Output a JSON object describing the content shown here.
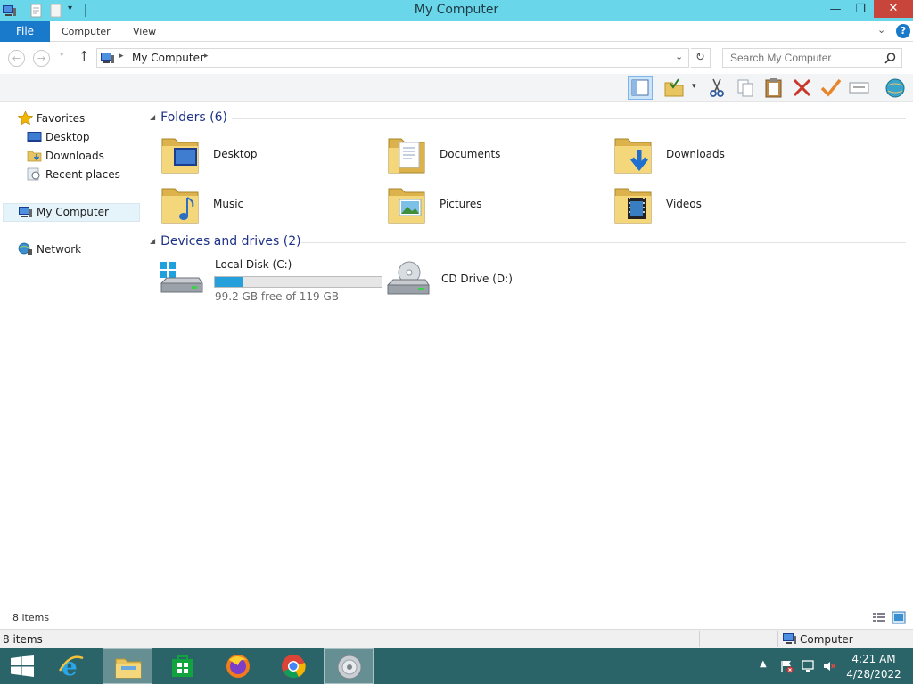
{
  "window": {
    "title": "My Computer"
  },
  "ribbon": {
    "tabs": [
      "File",
      "Computer",
      "View"
    ]
  },
  "address": {
    "path": "My Computer",
    "search_placeholder": "Search My Computer"
  },
  "navigation": {
    "favorites_label": "Favorites",
    "favorites": [
      "Desktop",
      "Downloads",
      "Recent places"
    ],
    "my_computer_label": "My Computer",
    "network_label": "Network"
  },
  "folders": {
    "header": "Folders (6)",
    "items": [
      {
        "name": "Desktop",
        "icon": "desktop-folder-icon"
      },
      {
        "name": "Documents",
        "icon": "documents-folder-icon"
      },
      {
        "name": "Downloads",
        "icon": "downloads-folder-icon"
      },
      {
        "name": "Music",
        "icon": "music-folder-icon"
      },
      {
        "name": "Pictures",
        "icon": "pictures-folder-icon"
      },
      {
        "name": "Videos",
        "icon": "videos-folder-icon"
      }
    ]
  },
  "drives": {
    "header": "Devices and drives (2)",
    "items": [
      {
        "name": "Local Disk (C:)",
        "free_text": "99.2 GB free of 119 GB",
        "used_fraction": 0.17,
        "icon": "hard-drive-icon"
      },
      {
        "name": "CD Drive (D:)",
        "icon": "cd-drive-icon"
      }
    ]
  },
  "status": {
    "item_count": "8 items",
    "bottom_count": "8 items",
    "location": "Computer"
  },
  "taskbar": {
    "time": "4:21 AM",
    "date": "4/28/2022",
    "apps": [
      "start-icon",
      "internet-explorer-icon",
      "file-explorer-icon",
      "store-icon",
      "firefox-icon",
      "chrome-icon",
      "speaker-app-icon"
    ]
  },
  "colors": {
    "titlebar": "#6ad6ea",
    "file_tab": "#1979ca",
    "taskbar": "#2a6468",
    "close_button": "#c7453a",
    "drive_fill": "#26a0da"
  }
}
